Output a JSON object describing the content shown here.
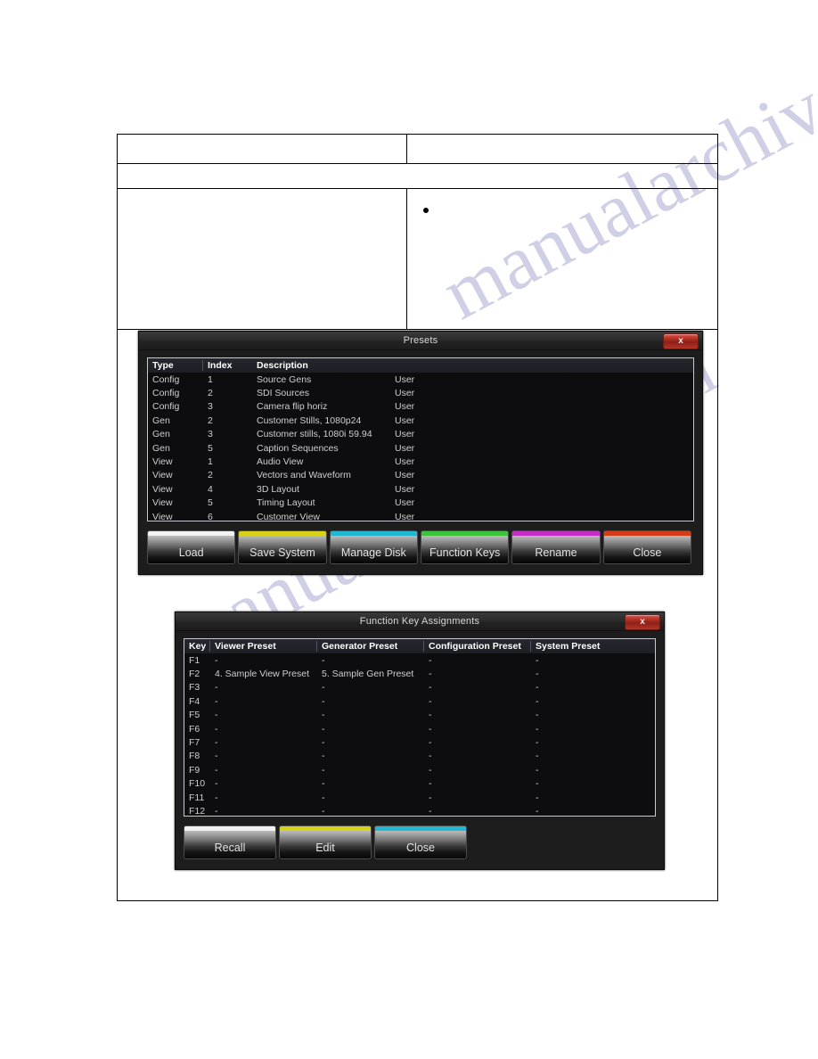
{
  "document": {
    "watermark_text_1": "manualarchive.com",
    "watermark_text_2": "manualarchive.com",
    "bullet": "•"
  },
  "presets_dialog": {
    "title": "Presets",
    "close_icon": "x",
    "columns": [
      "Type",
      "Index",
      "Description",
      ""
    ],
    "rows": [
      {
        "type": "Config",
        "index": "1",
        "description": "Source Gens",
        "owner": "User"
      },
      {
        "type": "Config",
        "index": "2",
        "description": "SDI Sources",
        "owner": "User"
      },
      {
        "type": "Config",
        "index": "3",
        "description": "Camera flip horiz",
        "owner": "User"
      },
      {
        "type": "Gen",
        "index": "2",
        "description": "Customer Stills, 1080p24",
        "owner": "User"
      },
      {
        "type": "Gen",
        "index": "3",
        "description": "Customer stills, 1080i 59.94",
        "owner": "User"
      },
      {
        "type": "Gen",
        "index": "5",
        "description": "Caption Sequences",
        "owner": "User"
      },
      {
        "type": "View",
        "index": "1",
        "description": "Audio View",
        "owner": "User"
      },
      {
        "type": "View",
        "index": "2",
        "description": "Vectors and Waveform",
        "owner": "User"
      },
      {
        "type": "View",
        "index": "4",
        "description": "3D Layout",
        "owner": "User"
      },
      {
        "type": "View",
        "index": "5",
        "description": "Timing Layout",
        "owner": "User"
      },
      {
        "type": "View",
        "index": "6",
        "description": "Customer View",
        "owner": "User"
      }
    ],
    "buttons": [
      {
        "label": "Load",
        "color": "#f2f2f2"
      },
      {
        "label": "Save System",
        "color": "#d7d119"
      },
      {
        "label": "Manage Disk",
        "color": "#22b8d4"
      },
      {
        "label": "Function Keys",
        "color": "#3cc43c"
      },
      {
        "label": "Rename",
        "color": "#c62cc6"
      },
      {
        "label": "Close",
        "color": "#d43c18"
      }
    ]
  },
  "function_keys_dialog": {
    "title": "Function Key Assignments",
    "close_icon": "x",
    "columns": [
      "Key",
      "Viewer Preset",
      "Generator Preset",
      "Configuration Preset",
      "System Preset"
    ],
    "rows": [
      {
        "key": "F1",
        "viewer": "-",
        "generator": "-",
        "configuration": "-",
        "system": "-"
      },
      {
        "key": "F2",
        "viewer": "4. Sample View Preset",
        "generator": "5. Sample Gen Preset",
        "configuration": "-",
        "system": "-"
      },
      {
        "key": "F3",
        "viewer": "-",
        "generator": "-",
        "configuration": "-",
        "system": "-"
      },
      {
        "key": "F4",
        "viewer": "-",
        "generator": "-",
        "configuration": "-",
        "system": "-"
      },
      {
        "key": "F5",
        "viewer": "-",
        "generator": "-",
        "configuration": "-",
        "system": "-"
      },
      {
        "key": "F6",
        "viewer": "-",
        "generator": "-",
        "configuration": "-",
        "system": "-"
      },
      {
        "key": "F7",
        "viewer": "-",
        "generator": "-",
        "configuration": "-",
        "system": "-"
      },
      {
        "key": "F8",
        "viewer": "-",
        "generator": "-",
        "configuration": "-",
        "system": "-"
      },
      {
        "key": "F9",
        "viewer": "-",
        "generator": "-",
        "configuration": "-",
        "system": "-"
      },
      {
        "key": "F10",
        "viewer": "-",
        "generator": "-",
        "configuration": "-",
        "system": "-"
      },
      {
        "key": "F11",
        "viewer": "-",
        "generator": "-",
        "configuration": "-",
        "system": "-"
      },
      {
        "key": "F12",
        "viewer": "-",
        "generator": "-",
        "configuration": "-",
        "system": "-"
      }
    ],
    "buttons": [
      {
        "label": "Recall",
        "color": "#f2f2f2"
      },
      {
        "label": "Edit",
        "color": "#d7d119"
      },
      {
        "label": "Close",
        "color": "#22b8d4"
      }
    ]
  }
}
